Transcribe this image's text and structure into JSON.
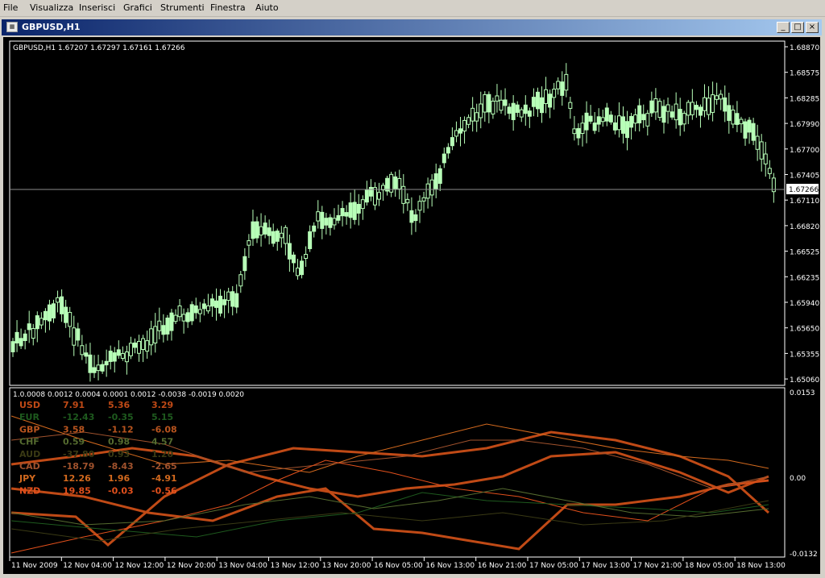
{
  "menu": [
    "File",
    "Visualizza",
    "Inserisci",
    "Grafici",
    "Strumenti",
    "Finestra",
    "Aiuto"
  ],
  "window": {
    "title": "GBPUSD,H1",
    "icon": "chart-window-icon",
    "buttons": [
      "minimize",
      "maximize",
      "close"
    ]
  },
  "chart": {
    "header": "GBPUSD,H1  1.67207 1.67297 1.67161 1.67266",
    "current_price": "1.67266",
    "price_labels": [
      "1.68870",
      "1.68575",
      "1.68285",
      "1.67990",
      "1.67700",
      "1.67405",
      "1.67110",
      "1.66820",
      "1.66525",
      "1.66235",
      "1.65940",
      "1.65650",
      "1.65355",
      "1.65060"
    ],
    "indicator_header": "1.0.0008 0.0012 0.0004 0.0001 0.0012 -0.0038 -0.0019 0.0020",
    "indicator_labels": [
      "0.0153",
      "0.00",
      "-0.0132"
    ],
    "time_labels": [
      "11 Nov 2009",
      "12 Nov 04:00",
      "12 Nov 12:00",
      "12 Nov 20:00",
      "13 Nov 04:00",
      "13 Nov 12:00",
      "13 Nov 20:00",
      "16 Nov 05:00",
      "16 Nov 13:00",
      "16 Nov 21:00",
      "17 Nov 05:00",
      "17 Nov 13:00",
      "17 Nov 21:00",
      "18 Nov 05:00",
      "18 Nov 13:00"
    ],
    "colors": {
      "background": "#000000",
      "candle": "#b8ffb8",
      "grid_text": "#ffffff",
      "current_line": "#8c8c8c"
    }
  },
  "strength_table": [
    {
      "cur": "USD",
      "v1": "7.91",
      "v2": "5.36",
      "v3": "3.29",
      "color": "#c04a16"
    },
    {
      "cur": "EUR",
      "v1": "-12.43",
      "v2": "-0.35",
      "v3": "5.15",
      "color": "#1e5a1e"
    },
    {
      "cur": "GBP",
      "v1": "3.58",
      "v2": "-1.12",
      "v3": "-6.08",
      "color": "#b8541e"
    },
    {
      "cur": "CHF",
      "v1": "0.59",
      "v2": "0.98",
      "v3": "4.57",
      "color": "#556b2f"
    },
    {
      "cur": "AUD",
      "v1": "-37.80",
      "v2": "0.93",
      "v3": "1.20",
      "color": "#3a3a14"
    },
    {
      "cur": "CAD",
      "v1": "-18.79",
      "v2": "-8.43",
      "v3": "-2.65",
      "color": "#a0522d"
    },
    {
      "cur": "JPY",
      "v1": "12.26",
      "v2": "1.96",
      "v3": "-4.91",
      "color": "#d2691e"
    },
    {
      "cur": "NZD",
      "v1": "19.85",
      "v2": "-0.03",
      "v3": "-0.56",
      "color": "#e2501c"
    }
  ]
}
